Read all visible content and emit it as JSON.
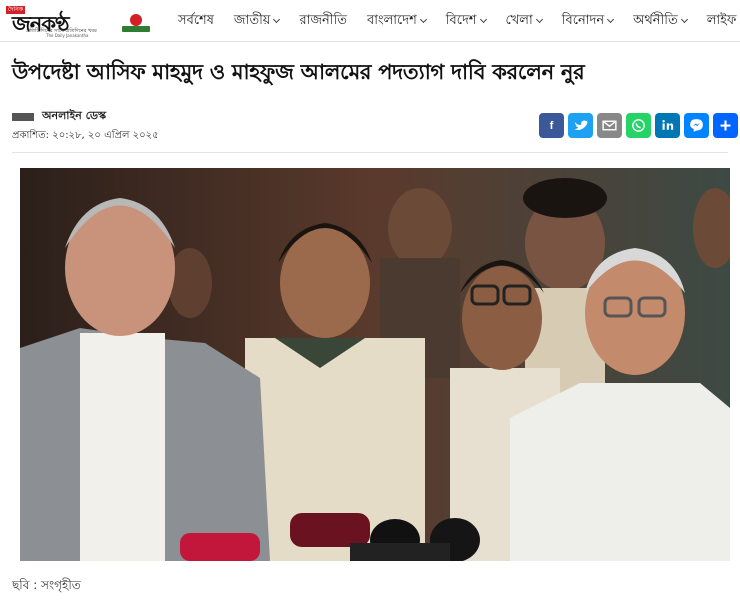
{
  "site": {
    "logo_tag": "দৈনিক",
    "logo_name": "জনকণ্ঠ",
    "logo_daily": "দৈনিক",
    "logo_slogan": "প্রতিটি দিনের সাথে প্রতিদিনের খবর",
    "logo_sub": "The Daily Janakantha"
  },
  "nav": {
    "items": [
      {
        "label": "সর্বশেষ",
        "has_dropdown": false
      },
      {
        "label": "জাতীয়",
        "has_dropdown": true
      },
      {
        "label": "রাজনীতি",
        "has_dropdown": false
      },
      {
        "label": "বাংলাদেশ",
        "has_dropdown": true
      },
      {
        "label": "বিদেশ",
        "has_dropdown": true
      },
      {
        "label": "খেলা",
        "has_dropdown": true
      },
      {
        "label": "বিনোদন",
        "has_dropdown": true
      },
      {
        "label": "অর্থনীতি",
        "has_dropdown": true
      },
      {
        "label": "লাইফ",
        "has_dropdown": false
      }
    ]
  },
  "article": {
    "headline": "উপদেষ্টা আসিফ মাহমুদ ও মাহফুজ আলমের পদত্যাগ দাবি করলেন নুর",
    "author": "অনলাইন ডেস্ক",
    "published": "প্রকাশিত: ২০:২৮, ২০ এপ্রিল ২০২৫",
    "caption": "ছবি : সংগৃহীত"
  },
  "share": [
    {
      "name": "facebook-share-button",
      "icon": "facebook-icon",
      "color": "#3b5998"
    },
    {
      "name": "twitter-share-button",
      "icon": "twitter-icon",
      "color": "#1da1f2"
    },
    {
      "name": "email-share-button",
      "icon": "email-icon",
      "color": "#888888"
    },
    {
      "name": "whatsapp-share-button",
      "icon": "whatsapp-icon",
      "color": "#25d366"
    },
    {
      "name": "linkedin-share-button",
      "icon": "linkedin-icon",
      "color": "#0077b5"
    },
    {
      "name": "messenger-share-button",
      "icon": "messenger-icon",
      "color": "#0084ff"
    },
    {
      "name": "more-share-button",
      "icon": "plus-icon",
      "color": "#0166ff"
    }
  ],
  "colors": {
    "brand_red": "#d31f26",
    "brand_green": "#2e7d32"
  }
}
